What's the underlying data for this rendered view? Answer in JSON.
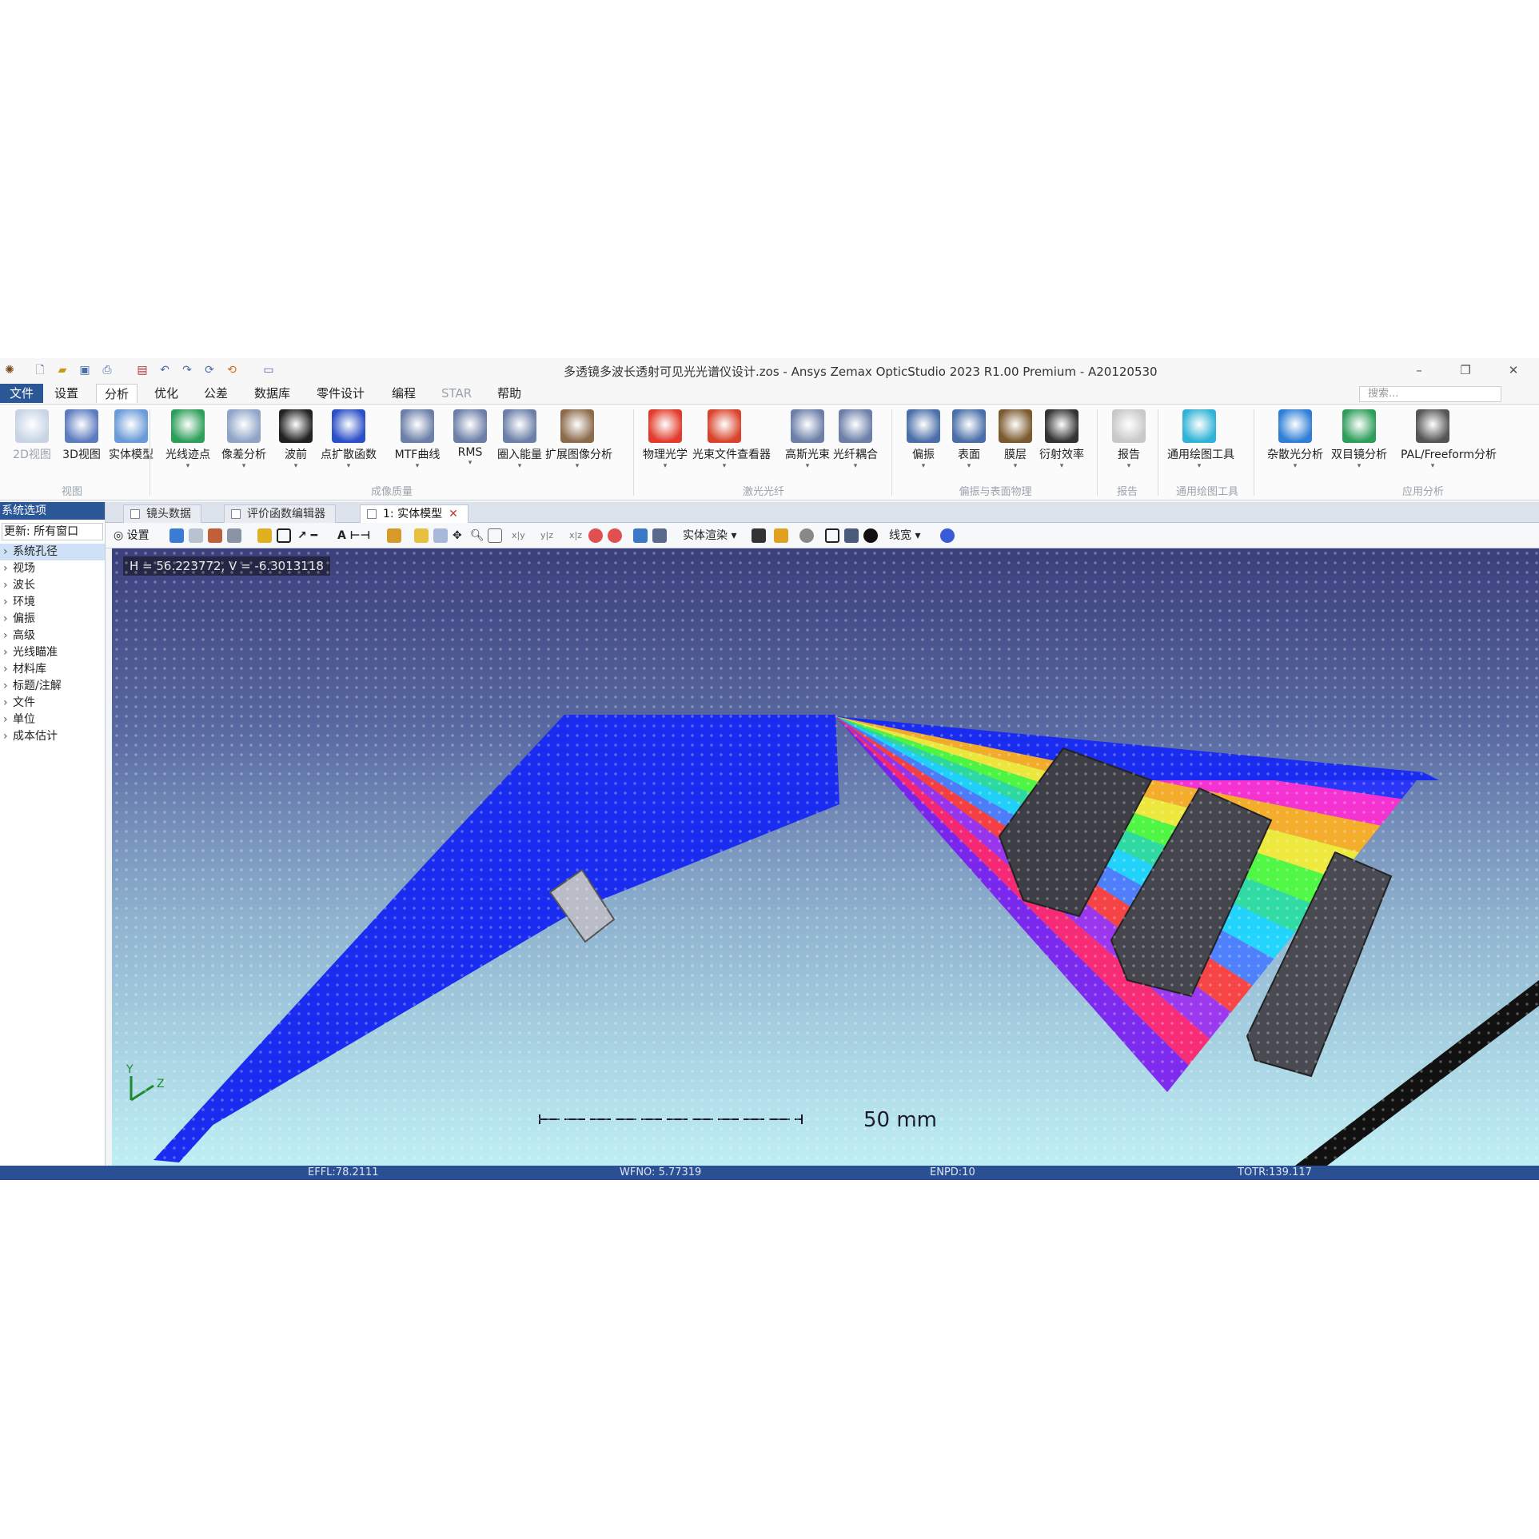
{
  "titlebar": {
    "title": "多透镜多波长透射可见光光谱仪设计.zos - Ansys Zemax OpticStudio 2023 R1.00   Premium - A20120530",
    "quick_access_icons": [
      "app-logo-icon",
      "new-file-icon",
      "open-folder-icon",
      "save-icon",
      "print-icon",
      "save-as-icon",
      "undo-icon",
      "redo-icon",
      "refresh-icon",
      "update-icon",
      "layout-icon"
    ],
    "window_controls": [
      "–",
      "❐",
      "✕"
    ]
  },
  "menu": {
    "tabs": [
      "文件",
      "设置",
      "分析",
      "优化",
      "公差",
      "数据库",
      "零件设计",
      "编程",
      "STAR",
      "帮助"
    ],
    "active": "分析",
    "search_placeholder": "搜索..."
  },
  "ribbon": {
    "buttons": [
      {
        "label": "2D视图",
        "icon": "2d-view-icon",
        "color": "#c8d4e6"
      },
      {
        "label": "3D视图",
        "icon": "3d-view-icon",
        "color": "#5d7cc0"
      },
      {
        "label": "实体模型",
        "icon": "solid-model-icon",
        "color": "#6a9bd8"
      },
      {
        "label": "光线迹点",
        "icon": "ray-trace-icon",
        "color": "#2e9e5b"
      },
      {
        "label": "像差分析",
        "icon": "aberration-icon",
        "color": "#8fa4c7"
      },
      {
        "label": "波前",
        "icon": "wavefront-icon",
        "color": "#222222"
      },
      {
        "label": "点扩散函数",
        "icon": "psf-icon",
        "color": "#2b4fc7"
      },
      {
        "label": "MTF曲线",
        "icon": "mtf-icon",
        "color": "#6c7fa8"
      },
      {
        "label": "RMS",
        "icon": "rms-icon",
        "color": "#6c7fa8"
      },
      {
        "label": "圈入能量",
        "icon": "encircled-energy-icon",
        "color": "#6c7fa8"
      },
      {
        "label": "扩展图像分析",
        "icon": "extended-image-icon",
        "color": "#8b6b4a"
      },
      {
        "label": "物理光学",
        "icon": "physical-optics-icon",
        "color": "#e23b2c"
      },
      {
        "label": "光束文件查看器",
        "icon": "beam-viewer-icon",
        "color": "#d9432b"
      },
      {
        "label": "高斯光束",
        "icon": "gaussian-beam-icon",
        "color": "#6c7fa8"
      },
      {
        "label": "光纤耦合",
        "icon": "fiber-coupling-icon",
        "color": "#6c7fa8"
      },
      {
        "label": "偏振",
        "icon": "polarization-icon",
        "color": "#4a6fa8"
      },
      {
        "label": "表面",
        "icon": "surface-icon",
        "color": "#4a6fa8"
      },
      {
        "label": "膜层",
        "icon": "coating-icon",
        "color": "#7a5a2e"
      },
      {
        "label": "衍射效率",
        "icon": "diffraction-icon",
        "color": "#333333"
      },
      {
        "label": "报告",
        "icon": "report-icon",
        "color": "#c8c8c8"
      },
      {
        "label": "通用绘图工具",
        "icon": "plot-tools-icon",
        "color": "#2fb3d6"
      },
      {
        "label": "杂散光分析",
        "icon": "stray-light-icon",
        "color": "#2f7fd6"
      },
      {
        "label": "双目镜分析",
        "icon": "binocular-icon",
        "color": "#2e9e5b"
      },
      {
        "label": "PAL/Freeform分析",
        "icon": "freeform-icon",
        "color": "#555555"
      }
    ],
    "groups": [
      "视图",
      "成像质量",
      "激光光纤",
      "偏振与表面物理",
      "报告",
      "通用绘图工具",
      "应用分析"
    ]
  },
  "left_panel": {
    "title": "系统选项",
    "update_label": "更新: 所有窗口",
    "items": [
      "系统孔径",
      "视场",
      "波长",
      "环境",
      "偏振",
      "高级",
      "光线瞄准",
      "材料库",
      "标题/注解",
      "文件",
      "单位",
      "成本估计"
    ]
  },
  "doc_tabs": [
    "镜头数据",
    "评价函数编辑器",
    "1: 实体模型"
  ],
  "viewer_toolbar": {
    "settings_label": "设置",
    "axes_labels": [
      "x|y",
      "y|z",
      "x|z"
    ],
    "render_label": "实体渲染",
    "wire_label": "线宽"
  },
  "viewport": {
    "coord_readout": "H = 56.223772, V = -6.3013118",
    "axis_y": "Y",
    "axis_z": "Z",
    "scale_label": "50 mm",
    "colors": {
      "beam": "#1a2cf0",
      "lens": "#3e3e46",
      "detector": "#111111",
      "spectrum": [
        "#7a1cf0",
        "#ff1e6e",
        "#9b2cf0",
        "#ff3a3a",
        "#4a7cff",
        "#19d7ff",
        "#28e0a0",
        "#4cff3a",
        "#f7f033",
        "#ffb020",
        "#ff2bd4",
        "#2430ff"
      ]
    }
  },
  "status": {
    "effl": "EFFL:78.2111",
    "wfno": "WFNO: 5.77319",
    "enpd": "ENPD:10",
    "totr": "TOTR:139.117"
  }
}
